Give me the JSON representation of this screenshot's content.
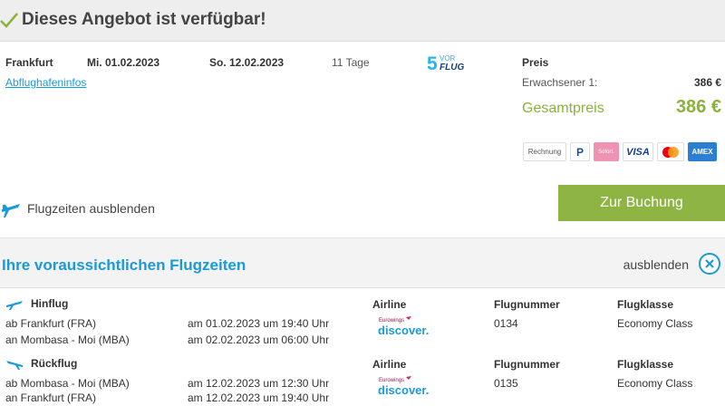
{
  "header": {
    "title": "Dieses Angebot ist verfügbar!"
  },
  "offer": {
    "departure_city": "Frankfurt",
    "depart_date": "Mi. 01.02.2023",
    "return_date": "So. 12.02.2023",
    "duration": "11 Tage",
    "airport_info_link": "Abflughafeninfos",
    "operator_logo": {
      "number": "5",
      "top_text": "VOR",
      "bottom_text": "FLUG"
    }
  },
  "price": {
    "heading": "Preis",
    "adult_label": "Erwachsener 1:",
    "adult_value": "386 €",
    "total_label": "Gesamtpreis",
    "total_value": "386 €"
  },
  "payments": [
    {
      "name": "Rechnung"
    },
    {
      "name": "P"
    },
    {
      "name": "Sofort."
    },
    {
      "name": "VISA"
    },
    {
      "name": "Mastercard"
    },
    {
      "name": "AMEX"
    }
  ],
  "actions": {
    "hide_flight_times": "Flugzeiten ausblenden",
    "book": "Zur Buchung"
  },
  "flight_times": {
    "title": "Ihre voraussichtlichen Flugzeiten",
    "hide_label": "ausblenden",
    "columns": {
      "airline": "Airline",
      "flight_number": "Flugnummer",
      "flight_class": "Flugklasse"
    },
    "outbound": {
      "label": "Hinflug",
      "from": "ab Frankfurt (FRA)",
      "from_time": "am 01.02.2023 um 19:40 Uhr",
      "to": "an Mombasa - Moi (MBA)",
      "to_time": "am 02.02.2023 um 06:00 Uhr",
      "flight_number": "0134",
      "flight_class": "Economy Class"
    },
    "return": {
      "label": "Rückflug",
      "from": "ab Mombasa - Moi (MBA)",
      "from_time": "am 12.02.2023 um 12:30 Uhr",
      "to": "an Frankfurt (FRA)",
      "to_time": "am 12.02.2023 um 19:40 Uhr",
      "flight_number": "0135",
      "flight_class": "Economy Class"
    },
    "airline_logo": {
      "small": "Eurowings",
      "big": "discover."
    }
  },
  "colors": {
    "accent_green": "#8eb443",
    "link_blue": "#1a9ad6",
    "header_bg": "#eeeeee"
  },
  "icons": [
    "check-icon",
    "plane-icon",
    "close-circle-icon"
  ]
}
